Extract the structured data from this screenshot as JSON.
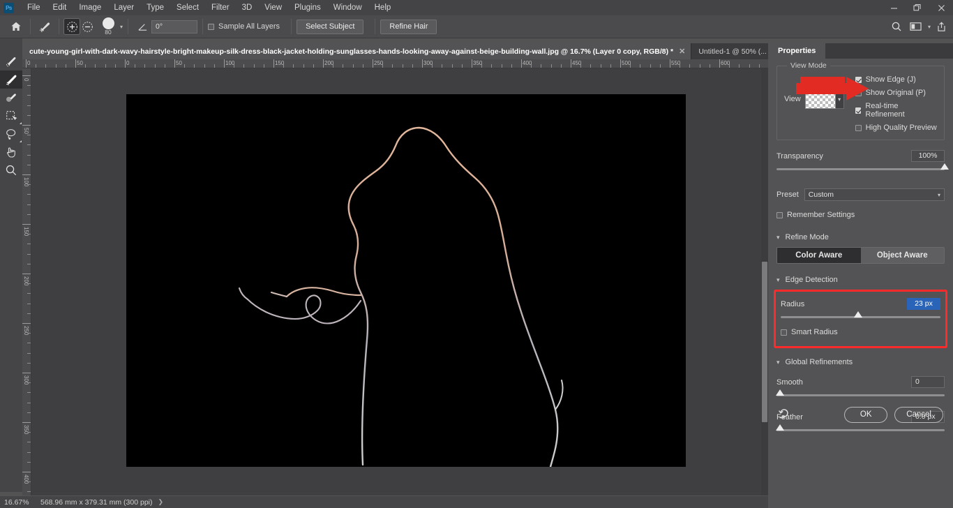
{
  "app": {
    "logo": "Ps",
    "menu": [
      "File",
      "Edit",
      "Image",
      "Layer",
      "Type",
      "Select",
      "Filter",
      "3D",
      "View",
      "Plugins",
      "Window",
      "Help"
    ],
    "window_controls": {
      "minimize": "minimize-icon",
      "restore": "restore-icon",
      "close": "close-icon"
    }
  },
  "options_bar": {
    "home_icon": "home-icon",
    "tool_icon": "refine-edge-brush-icon",
    "add_mode": "plus-icon",
    "subtract_mode": "minus-icon",
    "brush_size": "80",
    "brush_chevron": "chevron-down-icon",
    "angle_icon": "angle-icon",
    "angle_value": "0°",
    "sample_all_layers": {
      "label": "Sample All Layers",
      "checked": false
    },
    "select_subject": "Select Subject",
    "refine_hair": "Refine Hair",
    "search_icon": "search-icon",
    "workspace_icon": "workspace-icon",
    "workspace_chevron": "chevron-down-icon",
    "share_icon": "share-icon"
  },
  "toolbar": {
    "tools": [
      {
        "name": "quick-selection-tool",
        "glyph": "brush-light",
        "active": false
      },
      {
        "name": "refine-edge-brush-tool",
        "glyph": "brush-refine",
        "active": true
      },
      {
        "name": "brush-tool",
        "glyph": "brush-soft",
        "active": false
      },
      {
        "name": "object-selection-tool",
        "glyph": "object-select",
        "active": false
      },
      {
        "name": "lasso-tool",
        "glyph": "lasso",
        "active": false
      },
      {
        "name": "hand-tool",
        "glyph": "hand",
        "active": false
      },
      {
        "name": "zoom-tool",
        "glyph": "magnifier",
        "active": false
      }
    ]
  },
  "tabs": [
    {
      "label": "cute-young-girl-with-dark-wavy-hairstyle-bright-makeup-silk-dress-black-jacket-holding-sunglasses-hands-looking-away-against-beige-building-wall.jpg @ 16.7% (Layer 0 copy, RGB/8) *",
      "active": true,
      "close": "close-icon"
    },
    {
      "label": "Untitled-1 @ 50% (...",
      "active": false,
      "close": "close-icon"
    }
  ],
  "rulers": {
    "horizontal": [
      "0",
      "50",
      "0",
      "50",
      "100",
      "150",
      "200",
      "250",
      "300",
      "350",
      "400",
      "450",
      "500",
      "550",
      "600"
    ],
    "vertical": [
      "0",
      "50",
      "100",
      "150",
      "200",
      "250",
      "300",
      "350",
      "400"
    ]
  },
  "status_bar": {
    "zoom": "16.67%",
    "dimensions": "568.96 mm x 379.31 mm (300 ppi)",
    "next_arrow": "chevron-right-icon",
    "prev_arrow": "chevron-left-icon"
  },
  "properties_panel": {
    "tab_label": "Properties",
    "view_mode": {
      "legend": "View Mode",
      "view_label": "View",
      "view_thumbnail": "transparency-checker-icon",
      "view_chevron": "chevron-down-icon",
      "options": [
        {
          "label": "Show Edge (J)",
          "checked": true
        },
        {
          "label": "Show Original (P)",
          "checked": false
        },
        {
          "label": "Real-time Refinement",
          "checked": true
        },
        {
          "label": "High Quality Preview",
          "checked": false
        }
      ]
    },
    "transparency": {
      "label": "Transparency",
      "value": "100%",
      "knob_percent": 100
    },
    "preset": {
      "label": "Preset",
      "value": "Custom",
      "chevron": "chevron-down-icon"
    },
    "remember_settings": {
      "label": "Remember Settings",
      "checked": false
    },
    "refine_mode": {
      "header": "Refine Mode",
      "tri": "chevron-down-icon",
      "options": [
        {
          "label": "Color Aware",
          "selected": true
        },
        {
          "label": "Object Aware",
          "selected": false
        }
      ]
    },
    "edge_detection": {
      "header": "Edge Detection",
      "tri": "chevron-down-icon",
      "radius": {
        "label": "Radius",
        "value": "23 px",
        "selected": true,
        "knob_percent": 46
      },
      "smart_radius": {
        "label": "Smart Radius",
        "checked": false
      }
    },
    "global_refinements": {
      "header": "Global Refinements",
      "tri": "chevron-down-icon",
      "smooth": {
        "label": "Smooth",
        "value": "0",
        "knob_percent": 0
      },
      "feather": {
        "label": "Feather",
        "value": "0.0 px",
        "knob_percent": 0
      }
    },
    "footer": {
      "reset_icon": "reset-icon",
      "ok": "OK",
      "cancel": "Cancel"
    }
  },
  "annotations": {
    "arrow_color": "#ff2b2b",
    "box_color": "#ff2b2b",
    "arrow_target": "show-edge-checkbox",
    "box_target": "edge-detection-section"
  },
  "colors": {
    "accent_blue": "#2a64b8",
    "panel_bg": "#535355",
    "canvas_bg": "#3f3f41",
    "artboard_bg": "#000000"
  }
}
